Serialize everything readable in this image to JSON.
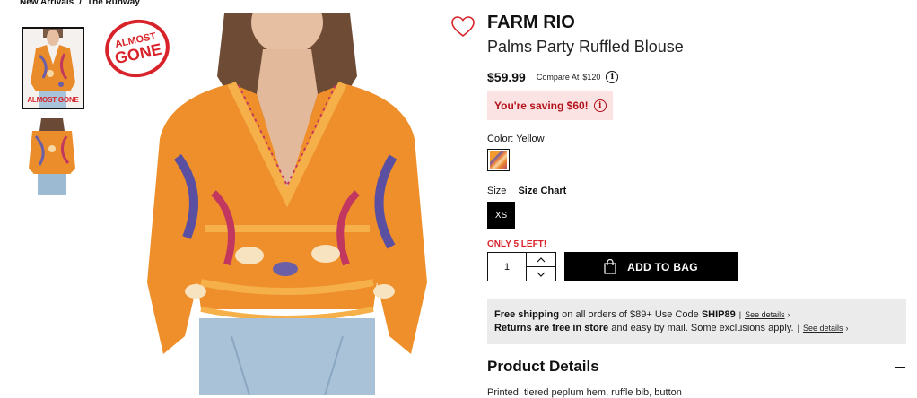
{
  "breadcrumb": {
    "items": [
      "New Arrivals",
      "The Runway"
    ],
    "separator": "/"
  },
  "gallery": {
    "thumb_badge": "ALMOST GONE",
    "main_badge_line1": "ALMOST",
    "main_badge_line2": "GONE"
  },
  "product": {
    "brand": "FARM RIO",
    "name": "Palms Party Ruffled Blouse",
    "price": "$59.99",
    "compare_label": "Compare At",
    "compare_value": "$120",
    "saving": "You're saving $60!",
    "color_label": "Color:",
    "color_value": "Yellow",
    "size_label": "Size",
    "size_chart": "Size Chart",
    "size_selected": "XS",
    "stock_note": "ONLY 5 LEFT!",
    "quantity": "1",
    "add_to_bag": "ADD TO BAG"
  },
  "promo": {
    "line1_bold": "Free shipping",
    "line1_text": " on all orders of $89+ Use Code ",
    "line1_code": "SHIP89",
    "line2_bold": "Returns are free in store",
    "line2_text": " and easy by mail. Some exclusions apply.",
    "see_details": "See details",
    "chevron": "›"
  },
  "details": {
    "title": "Product Details",
    "text": "Printed, tiered peplum hem, ruffle bib, button"
  },
  "icons": {
    "wishlist": "heart-icon",
    "info": "info-icon",
    "bag": "shopping-bag-icon",
    "collapse": "minus-icon"
  },
  "colors": {
    "accent_red": "#d8232a",
    "saving_bg": "#fbe3e4",
    "promo_bg": "#ebebeb"
  }
}
